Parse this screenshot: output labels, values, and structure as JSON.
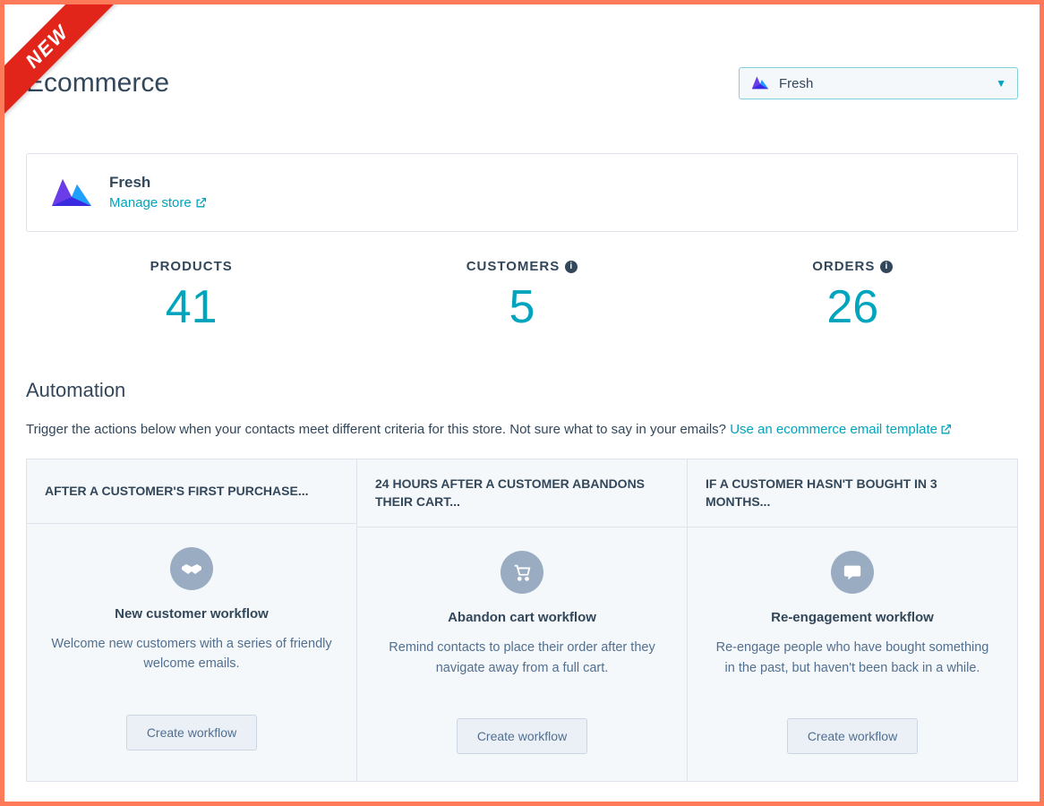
{
  "badge": {
    "new_label": "NEW"
  },
  "header": {
    "title": "Ecommerce",
    "dropdown": {
      "selected_label": "Fresh"
    }
  },
  "store_card": {
    "name": "Fresh",
    "manage_label": "Manage store"
  },
  "metrics": {
    "products": {
      "label": "PRODUCTS",
      "value": "41"
    },
    "customers": {
      "label": "CUSTOMERS",
      "value": "5"
    },
    "orders": {
      "label": "ORDERS",
      "value": "26"
    }
  },
  "automation": {
    "title": "Automation",
    "subtitle_plain": "Trigger the actions below when your contacts meet different criteria for this store. Not sure what to say in your emails? ",
    "template_link_label": "Use an ecommerce email template",
    "workflows": [
      {
        "header": "AFTER A CUSTOMER'S FIRST PURCHASE...",
        "name": "New customer workflow",
        "description": "Welcome new customers with a series of friendly welcome emails.",
        "button_label": "Create workflow",
        "icon": "handshake-icon"
      },
      {
        "header": "24 HOURS AFTER A CUSTOMER ABANDONS THEIR CART...",
        "name": "Abandon cart workflow",
        "description": "Remind contacts to place their order after they navigate away from a full cart.",
        "button_label": "Create workflow",
        "icon": "cart-icon"
      },
      {
        "header": "IF A CUSTOMER HASN'T BOUGHT IN 3 MONTHS...",
        "name": "Re-engagement workflow",
        "description": "Re-engage people who have bought something in the past, but haven't been back in a while.",
        "button_label": "Create workflow",
        "icon": "chat-icon"
      }
    ]
  }
}
